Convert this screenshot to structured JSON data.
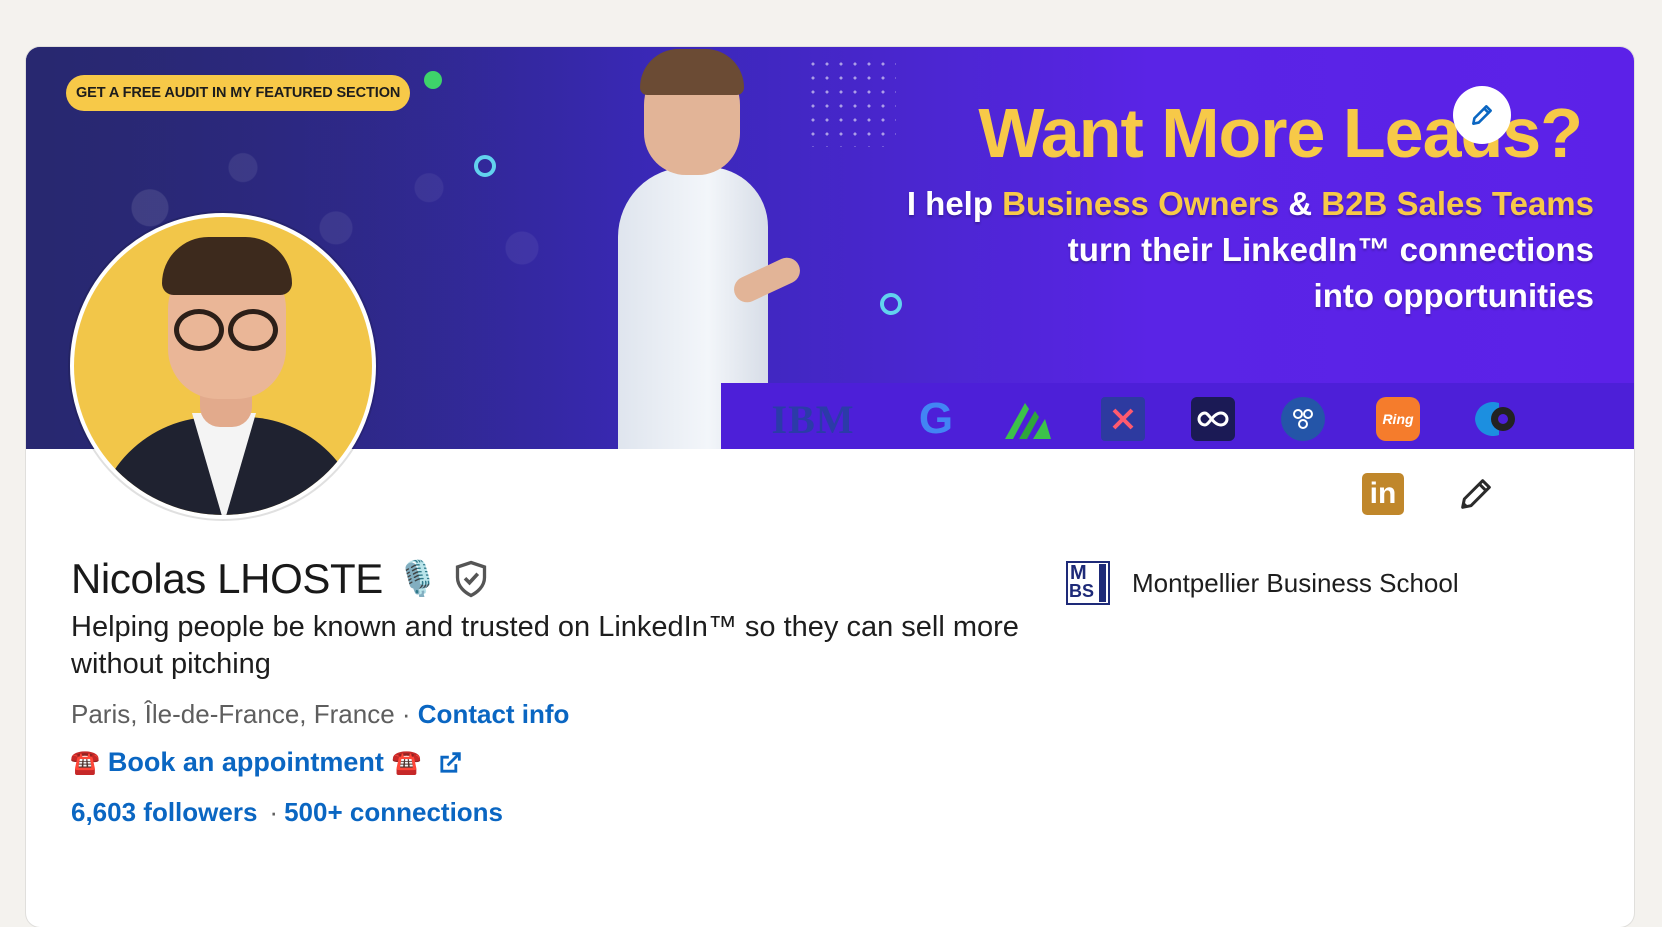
{
  "banner": {
    "promo_pill": "GET A FREE AUDIT IN MY FEATURED SECTION",
    "headline": "Want More Leads?",
    "line1_prefix": "I help ",
    "line1_highlight1": "Business Owners",
    "line1_amp": " & ",
    "line1_highlight2": "B2B Sales Teams",
    "line2": "turn their LinkedIn™ connections",
    "line3": "into opportunities",
    "logos": [
      "IBM",
      "G",
      "Ring"
    ]
  },
  "profile": {
    "name": "Nicolas LHOSTE",
    "name_emoji": "🎙️",
    "headline": "Helping people be known and trusted on LinkedIn™ so they can sell more without pitching",
    "location": "Paris, Île-de-France, France",
    "location_sep": " · ",
    "contact_info": "Contact info",
    "appointment_emoji": "☎️",
    "appointment_label": "Book an appointment",
    "followers": "6,603 followers",
    "stats_sep": "·",
    "connections": "500+ connections"
  },
  "education": {
    "school": "Montpellier Business School",
    "logo_text_top": "M",
    "logo_text_bottom": "BS"
  },
  "actions": {
    "linkedin_badge": "in"
  },
  "colors": {
    "link": "#0a66c2",
    "accent_yellow": "#f7c948",
    "linkedin_badge": "#c0872b"
  }
}
